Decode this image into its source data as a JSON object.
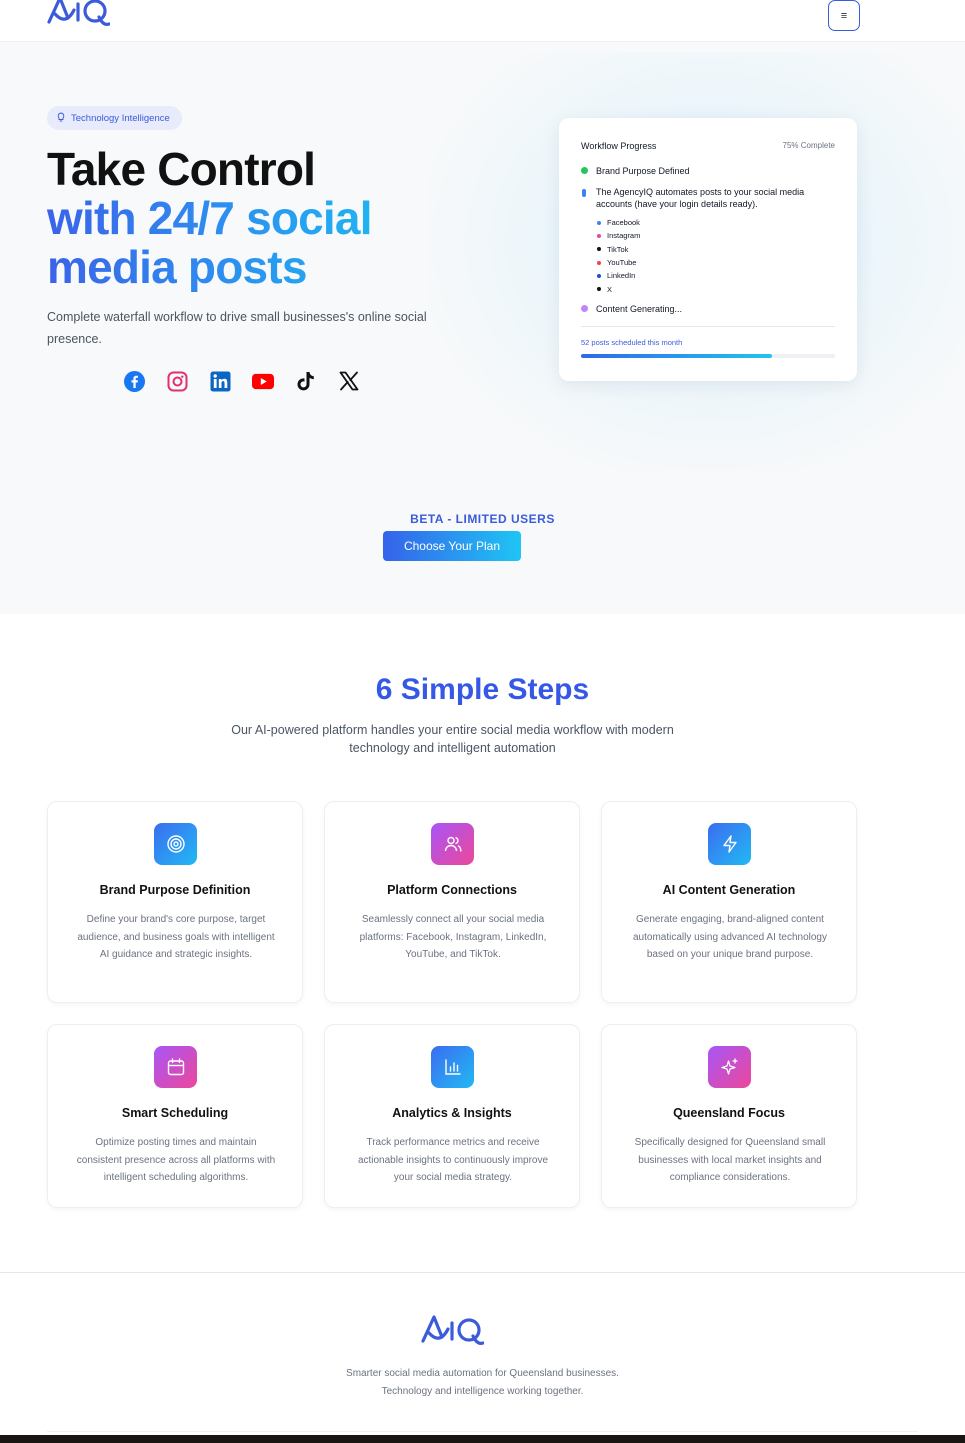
{
  "header": {
    "logo_text": "AIQ",
    "menu_icon": "≡"
  },
  "hero": {
    "tag": "Technology Intelligence",
    "title_line1": "Take Control",
    "title_line2": "with 24/7 social",
    "title_line3": "media posts",
    "subtitle": "Complete waterfall workflow to drive small businesses's online social presence.",
    "social_icons": [
      "facebook-icon",
      "instagram-icon",
      "linkedin-icon",
      "youtube-icon",
      "tiktok-icon",
      "x-icon"
    ],
    "beta_label": "BETA - LIMITED USERS",
    "cta_label": "Choose Your Plan"
  },
  "workflow": {
    "title": "Workflow Progress",
    "percent": "75% Complete",
    "step1": "Brand Purpose Defined",
    "step2": "The AgencyIQ automates posts to your social media accounts (have your login details ready).",
    "platforms": [
      {
        "name": "Facebook",
        "color": "#3b82f6"
      },
      {
        "name": "Instagram",
        "color": "#ec4899"
      },
      {
        "name": "TikTok",
        "color": "#111111"
      },
      {
        "name": "YouTube",
        "color": "#ef4444"
      },
      {
        "name": "LinkedIn",
        "color": "#1d4ed8"
      },
      {
        "name": "X",
        "color": "#111111"
      }
    ],
    "step3": "Content Generating...",
    "scheduled": "52 posts scheduled this month",
    "progress_fraction": 0.75
  },
  "steps": {
    "title": "6 Simple Steps",
    "subtitle": "Our AI-powered platform handles your entire social media workflow with modern technology and intelligent automation",
    "cards": [
      {
        "title": "Brand Purpose Definition",
        "desc": "Define your brand's core purpose, target audience, and business goals with intelligent AI guidance and strategic insights.",
        "icon": "target-icon"
      },
      {
        "title": "Platform Connections",
        "desc": "Seamlessly connect all your social media platforms: Facebook, Instagram, LinkedIn, YouTube, and TikTok.",
        "icon": "users-icon"
      },
      {
        "title": "AI Content Generation",
        "desc": "Generate engaging, brand-aligned content automatically using advanced AI technology based on your unique brand purpose.",
        "icon": "lightning-icon"
      },
      {
        "title": "Smart Scheduling",
        "desc": "Optimize posting times and maintain consistent presence across all platforms with intelligent scheduling algorithms.",
        "icon": "calendar-icon"
      },
      {
        "title": "Analytics & Insights",
        "desc": "Track performance metrics and receive actionable insights to continuously improve your social media strategy.",
        "icon": "bar-chart-icon"
      },
      {
        "title": "Queensland Focus",
        "desc": "Specifically designed for Queensland small businesses with local market insights and compliance considerations.",
        "icon": "sparkles-icon"
      }
    ]
  },
  "footer": {
    "logo_text": "AIQ",
    "line1": "Smarter social media automation for Queensland businesses.",
    "line2": "Technology and intelligence working together."
  }
}
